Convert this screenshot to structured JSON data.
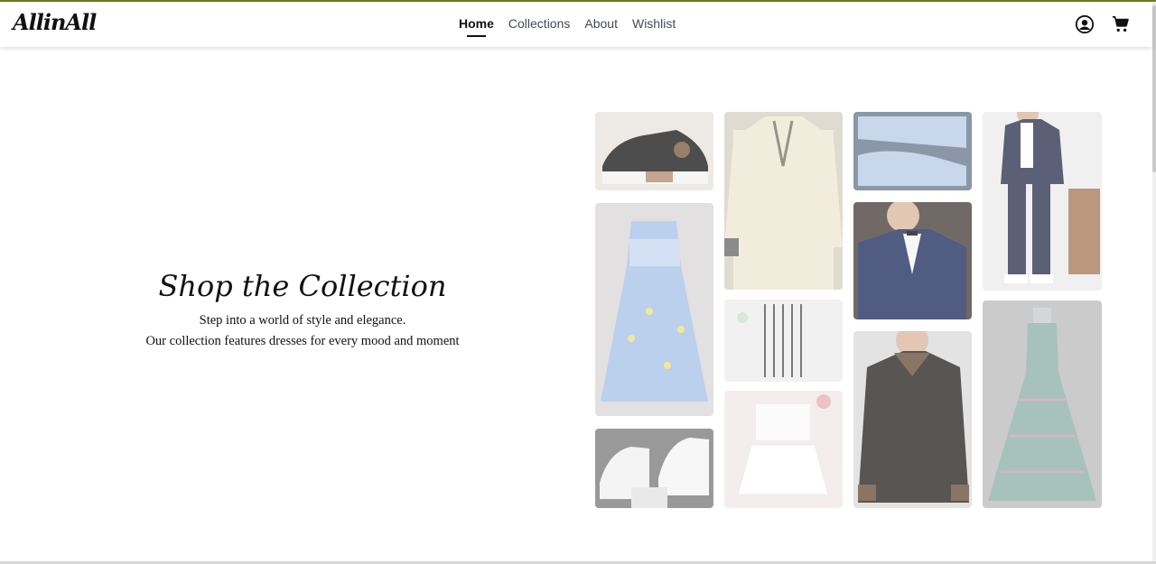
{
  "navbar": {
    "logo": "AllinAll",
    "links": [
      {
        "label": "Home",
        "active": true
      },
      {
        "label": "Collections",
        "active": false
      },
      {
        "label": "About",
        "active": false
      },
      {
        "label": "Wishlist",
        "active": false
      }
    ],
    "icons": [
      "user-icon",
      "cart-icon"
    ]
  },
  "hero": {
    "title": "Shop the Collection",
    "line1": "Step into a world of style and elegance.",
    "line2": "Our collection features dresses for every mood and moment"
  },
  "gallery": {
    "images": [
      "sneaker-bear-image",
      "kurta-shirt-image",
      "dior-sneaker-image",
      "navy-suit-man-image",
      "floral-dress-image",
      "tuxedo-image",
      "striped-jumpsuit-image",
      "white-sneaker-image",
      "white-top-skirt-image",
      "leather-jacket-image",
      "gown-image"
    ]
  },
  "colors": {
    "accent_border": "#6b7a1e",
    "text": "#111111"
  }
}
